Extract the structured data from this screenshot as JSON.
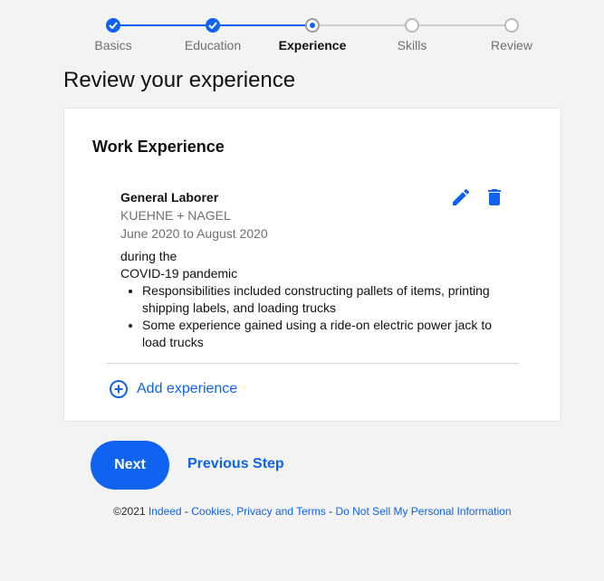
{
  "colors": {
    "accent": "#0f63f0",
    "inactive": "#b9b9b9",
    "background": "#f3f3f3"
  },
  "stepper": {
    "steps": [
      {
        "label": "Basics",
        "state": "done"
      },
      {
        "label": "Education",
        "state": "done"
      },
      {
        "label": "Experience",
        "state": "current"
      },
      {
        "label": "Skills",
        "state": "todo"
      },
      {
        "label": "Review",
        "state": "todo"
      }
    ]
  },
  "page": {
    "title": "Review your experience"
  },
  "card": {
    "title": "Work Experience",
    "job": {
      "title": "General Laborer",
      "company": "KUEHNE + NAGEL",
      "dates": "June 2020 to August 2020",
      "intro_line1": "during the",
      "intro_line2": "COVID-19 pandemic",
      "bullets": [
        "Responsibilities included constructing pallets of items, printing shipping labels, and loading trucks",
        "Some experience gained using a ride-on electric power jack to load trucks"
      ]
    },
    "edit_icon": "pencil-icon",
    "delete_icon": "trash-icon",
    "add_label": "Add experience",
    "add_icon": "plus-circle-icon"
  },
  "actions": {
    "next_label": "Next",
    "previous_label": "Previous Step"
  },
  "footer": {
    "copyright": "©2021",
    "brand_link": "Indeed",
    "sep1": " - ",
    "terms_link": "Cookies, Privacy and Terms",
    "sep2": " - ",
    "privacy_link": "Do Not Sell My Personal Information"
  }
}
